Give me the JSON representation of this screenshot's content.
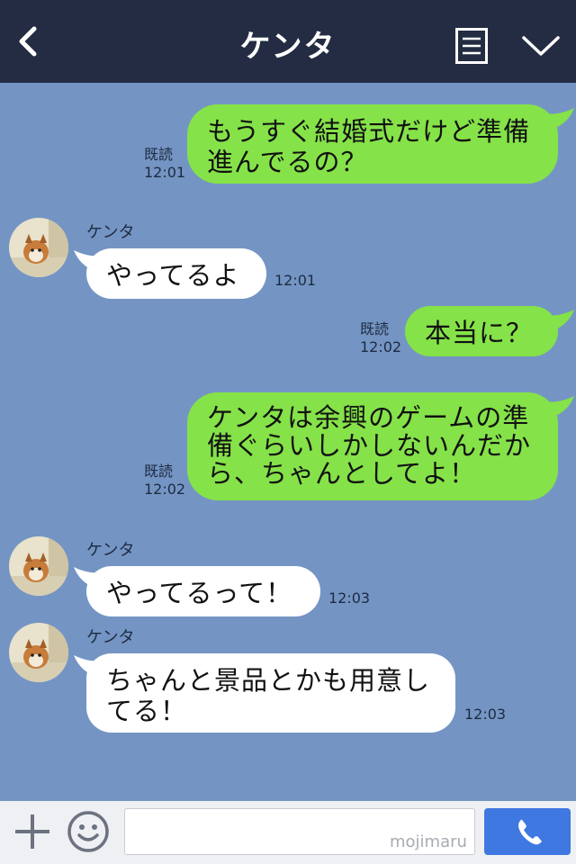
{
  "header": {
    "title": "ケンタ"
  },
  "messages": [
    {
      "from": "me",
      "text": "もうすぐ結婚式だけど準備\n進んでるの？",
      "read": "既読",
      "time": "12:01"
    },
    {
      "from": "them",
      "sender": "ケンタ",
      "text": "やってるよ",
      "time": "12:01"
    },
    {
      "from": "me",
      "text": "本当に？",
      "read": "既読",
      "time": "12:02"
    },
    {
      "from": "me",
      "text": "ケンタは余興のゲームの準\n備ぐらいしかしないんだか\nら、ちゃんとしてよ！",
      "read": "既読",
      "time": "12:02"
    },
    {
      "from": "them",
      "sender": "ケンタ",
      "text": "やってるって！",
      "time": "12:03"
    },
    {
      "from": "them",
      "sender": "ケンタ",
      "text": "ちゃんと景品とかも用意し\nてる！",
      "time": "12:03"
    }
  ],
  "input": {
    "placeholder": "",
    "watermark": "mojimaru"
  },
  "colors": {
    "header_bg": "#232c42",
    "chat_bg": "#7495c3",
    "my_bubble": "#85e249",
    "their_bubble": "#ffffff",
    "call_button": "#3f78e0"
  },
  "icons": {
    "back": "chevron-left-icon",
    "notes": "notes-icon",
    "menu": "chevron-down-icon",
    "add": "plus-icon",
    "emoji": "smiley-icon",
    "call": "phone-icon"
  }
}
